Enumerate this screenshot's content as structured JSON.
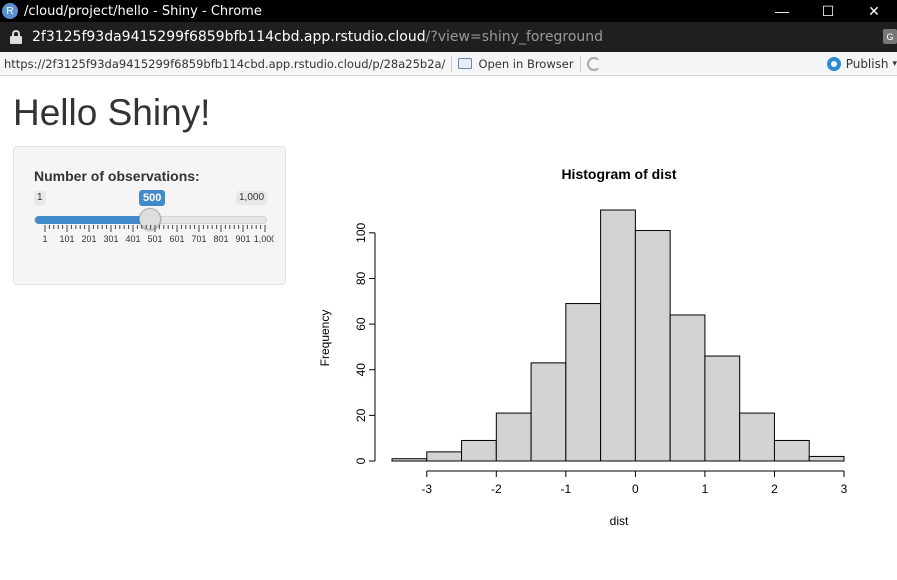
{
  "window": {
    "app_icon": "R",
    "title": "/cloud/project/hello - Shiny - Chrome",
    "buttons": {
      "minimize": "—",
      "maximize": "☐",
      "close": "✕"
    }
  },
  "addressbar": {
    "host": "2f3125f93da9415299f6859bfb114cbd.app.rstudio.cloud",
    "path": "/?view=shiny_foreground",
    "translate_icon": "translate-icon"
  },
  "viewer": {
    "url": "https://2f3125f93da9415299f6859bfb114cbd.app.rstudio.cloud/p/28a25b2a/",
    "open_in_browser": "Open in Browser",
    "publish": "Publish",
    "icons": {
      "open": "open-window-icon",
      "refresh": "refresh-icon",
      "publish": "publish-icon"
    }
  },
  "app": {
    "title": "Hello Shiny!",
    "slider": {
      "label": "Number of observations:",
      "min_label": "1",
      "max_label": "1,000",
      "value_label": "500",
      "min": 1,
      "max": 1000,
      "value": 500,
      "tick_labels": [
        "1",
        "101",
        "201",
        "301",
        "401",
        "501",
        "601",
        "701",
        "801",
        "901",
        "1,000"
      ],
      "accent_color": "#428bca"
    }
  },
  "chart_data": {
    "type": "bar",
    "title": "Histogram of dist",
    "xlabel": "dist",
    "ylabel": "Frequency",
    "bins": [
      {
        "x0": -3.5,
        "x1": -3.0,
        "count": 1
      },
      {
        "x0": -3.0,
        "x1": -2.5,
        "count": 4
      },
      {
        "x0": -2.5,
        "x1": -2.0,
        "count": 9
      },
      {
        "x0": -2.0,
        "x1": -1.5,
        "count": 21
      },
      {
        "x0": -1.5,
        "x1": -1.0,
        "count": 43
      },
      {
        "x0": -1.0,
        "x1": -0.5,
        "count": 69
      },
      {
        "x0": -0.5,
        "x1": 0.0,
        "count": 110
      },
      {
        "x0": 0.0,
        "x1": 0.5,
        "count": 101
      },
      {
        "x0": 0.5,
        "x1": 1.0,
        "count": 64
      },
      {
        "x0": 1.0,
        "x1": 1.5,
        "count": 46
      },
      {
        "x0": 1.5,
        "x1": 2.0,
        "count": 21
      },
      {
        "x0": 2.0,
        "x1": 2.5,
        "count": 9
      },
      {
        "x0": 2.5,
        "x1": 3.0,
        "count": 2
      }
    ],
    "xticks": [
      -3,
      -2,
      -1,
      0,
      1,
      2,
      3
    ],
    "yticks": [
      0,
      20,
      40,
      60,
      80,
      100
    ],
    "xlim": [
      -3.5,
      3.0
    ],
    "ylim": [
      0,
      110
    ],
    "bar_color": "#d3d3d3",
    "grid": false
  }
}
